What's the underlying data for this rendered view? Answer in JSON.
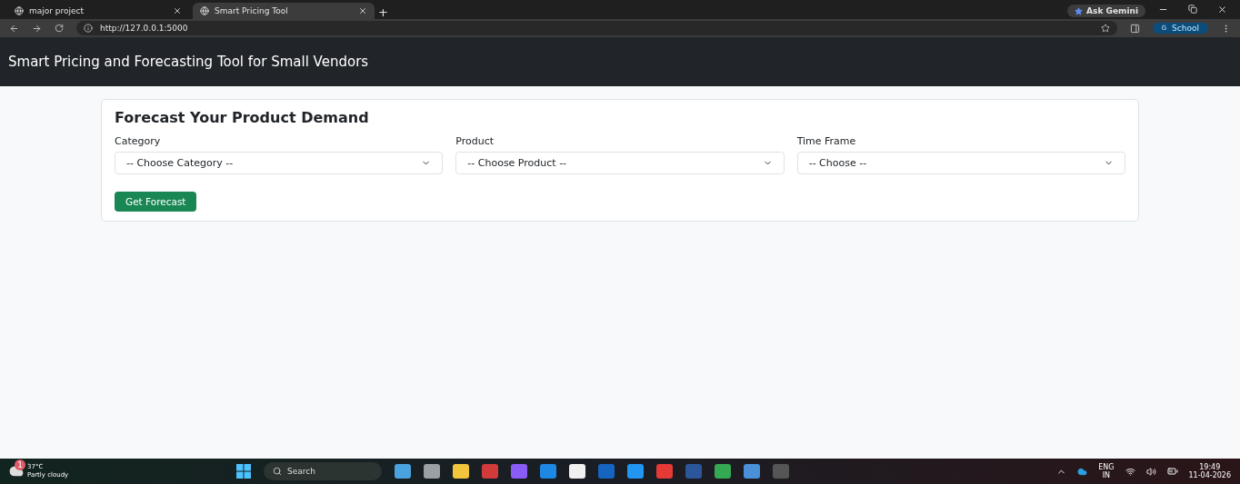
{
  "browser": {
    "tabs": [
      {
        "label": "major project",
        "selected": false
      },
      {
        "label": "Smart Pricing Tool",
        "selected": true
      }
    ],
    "new_tab": "+",
    "ask": "Ask Gemini",
    "url": "http://127.0.0.1:5000",
    "profile_initial": "G",
    "profile": "School"
  },
  "navbar": {
    "title": "Smart Pricing and Forecasting Tool for Small Vendors"
  },
  "card": {
    "heading": "Forecast Your Product Demand",
    "fields": [
      {
        "label": "Category",
        "value": "-- Choose Category --"
      },
      {
        "label": "Product",
        "value": "-- Choose Product --"
      },
      {
        "label": "Time Frame",
        "value": "-- Choose --"
      }
    ],
    "button": "Get Forecast"
  },
  "taskbar": {
    "temperature": "37°C",
    "weather": "Partly cloudy",
    "weather_badge": "1",
    "search": "Search",
    "language": "ENG",
    "region": "IN",
    "time": "19:49",
    "date": "11-04-2026"
  }
}
